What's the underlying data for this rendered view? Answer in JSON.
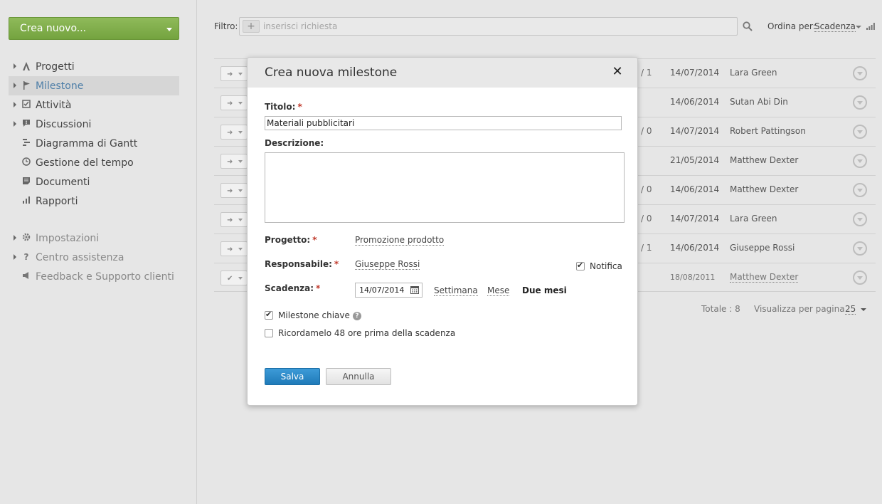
{
  "sidebar": {
    "create_label": "Crea nuovo...",
    "items": [
      {
        "label": "Progetti",
        "icon": "projects-icon"
      },
      {
        "label": "Milestone",
        "icon": "flag-icon"
      },
      {
        "label": "Attività",
        "icon": "checkbox-icon"
      },
      {
        "label": "Discussioni",
        "icon": "chat-icon"
      },
      {
        "label": "Diagramma di Gantt",
        "icon": "gantt-icon"
      },
      {
        "label": "Gestione del tempo",
        "icon": "clock-icon"
      },
      {
        "label": "Documenti",
        "icon": "document-icon"
      },
      {
        "label": "Rapporti",
        "icon": "chart-icon"
      }
    ],
    "secondary": [
      {
        "label": "Impostazioni",
        "icon": "gear-icon"
      },
      {
        "label": "Centro assistenza",
        "icon": "question-icon"
      },
      {
        "label": "Feedback e Supporto clienti",
        "icon": "megaphone-icon"
      }
    ]
  },
  "toolbar": {
    "filter_label": "Filtro:",
    "filter_placeholder": "inserisci richiesta",
    "sort_label": "Ordina per:",
    "sort_value": "Scadenza"
  },
  "table": {
    "rows": [
      {
        "count": "/ 1",
        "date": "14/07/2014",
        "person": "Lara Green"
      },
      {
        "count": "",
        "date": "14/06/2014",
        "person": "Sutan Abi Din"
      },
      {
        "count": "/ 0",
        "date": "14/07/2014",
        "person": "Robert Pattingson"
      },
      {
        "count": "",
        "date": "21/05/2014",
        "person": "Matthew Dexter"
      },
      {
        "count": "/ 0",
        "date": "14/06/2014",
        "person": "Matthew Dexter"
      },
      {
        "count": "/ 0",
        "date": "14/07/2014",
        "person": "Lara Green"
      },
      {
        "count": "/ 1",
        "date": "14/06/2014",
        "person": "Giuseppe Rossi"
      },
      {
        "count": "",
        "date": "18/08/2011",
        "person": "Matthew Dexter"
      }
    ],
    "total": "Totale : 8",
    "per_page_label": "Visualizza per pagina :",
    "per_page_value": "25"
  },
  "modal": {
    "title": "Crea nuova milestone",
    "title_label": "Titolo:",
    "title_value": "Materiali pubblicitari",
    "description_label": "Descrizione:",
    "project_label": "Progetto:",
    "project_value": "Promozione prodotto",
    "responsible_label": "Responsabile:",
    "responsible_value": "Giuseppe Rossi",
    "notify_label": "Notifica",
    "deadline_label": "Scadenza:",
    "deadline_value": "14/07/2014",
    "ranges": [
      "Settimana",
      "Mese",
      "Due mesi"
    ],
    "key_milestone_label": "Milestone chiave",
    "remind_label": "Ricordamelo 48 ore prima della scadenza",
    "save_label": "Salva",
    "cancel_label": "Annulla",
    "required_mark": "*"
  },
  "colors": {
    "accent_green": "#74a33f",
    "save_blue": "#1f7ab8",
    "required_red": "#c0392b"
  }
}
